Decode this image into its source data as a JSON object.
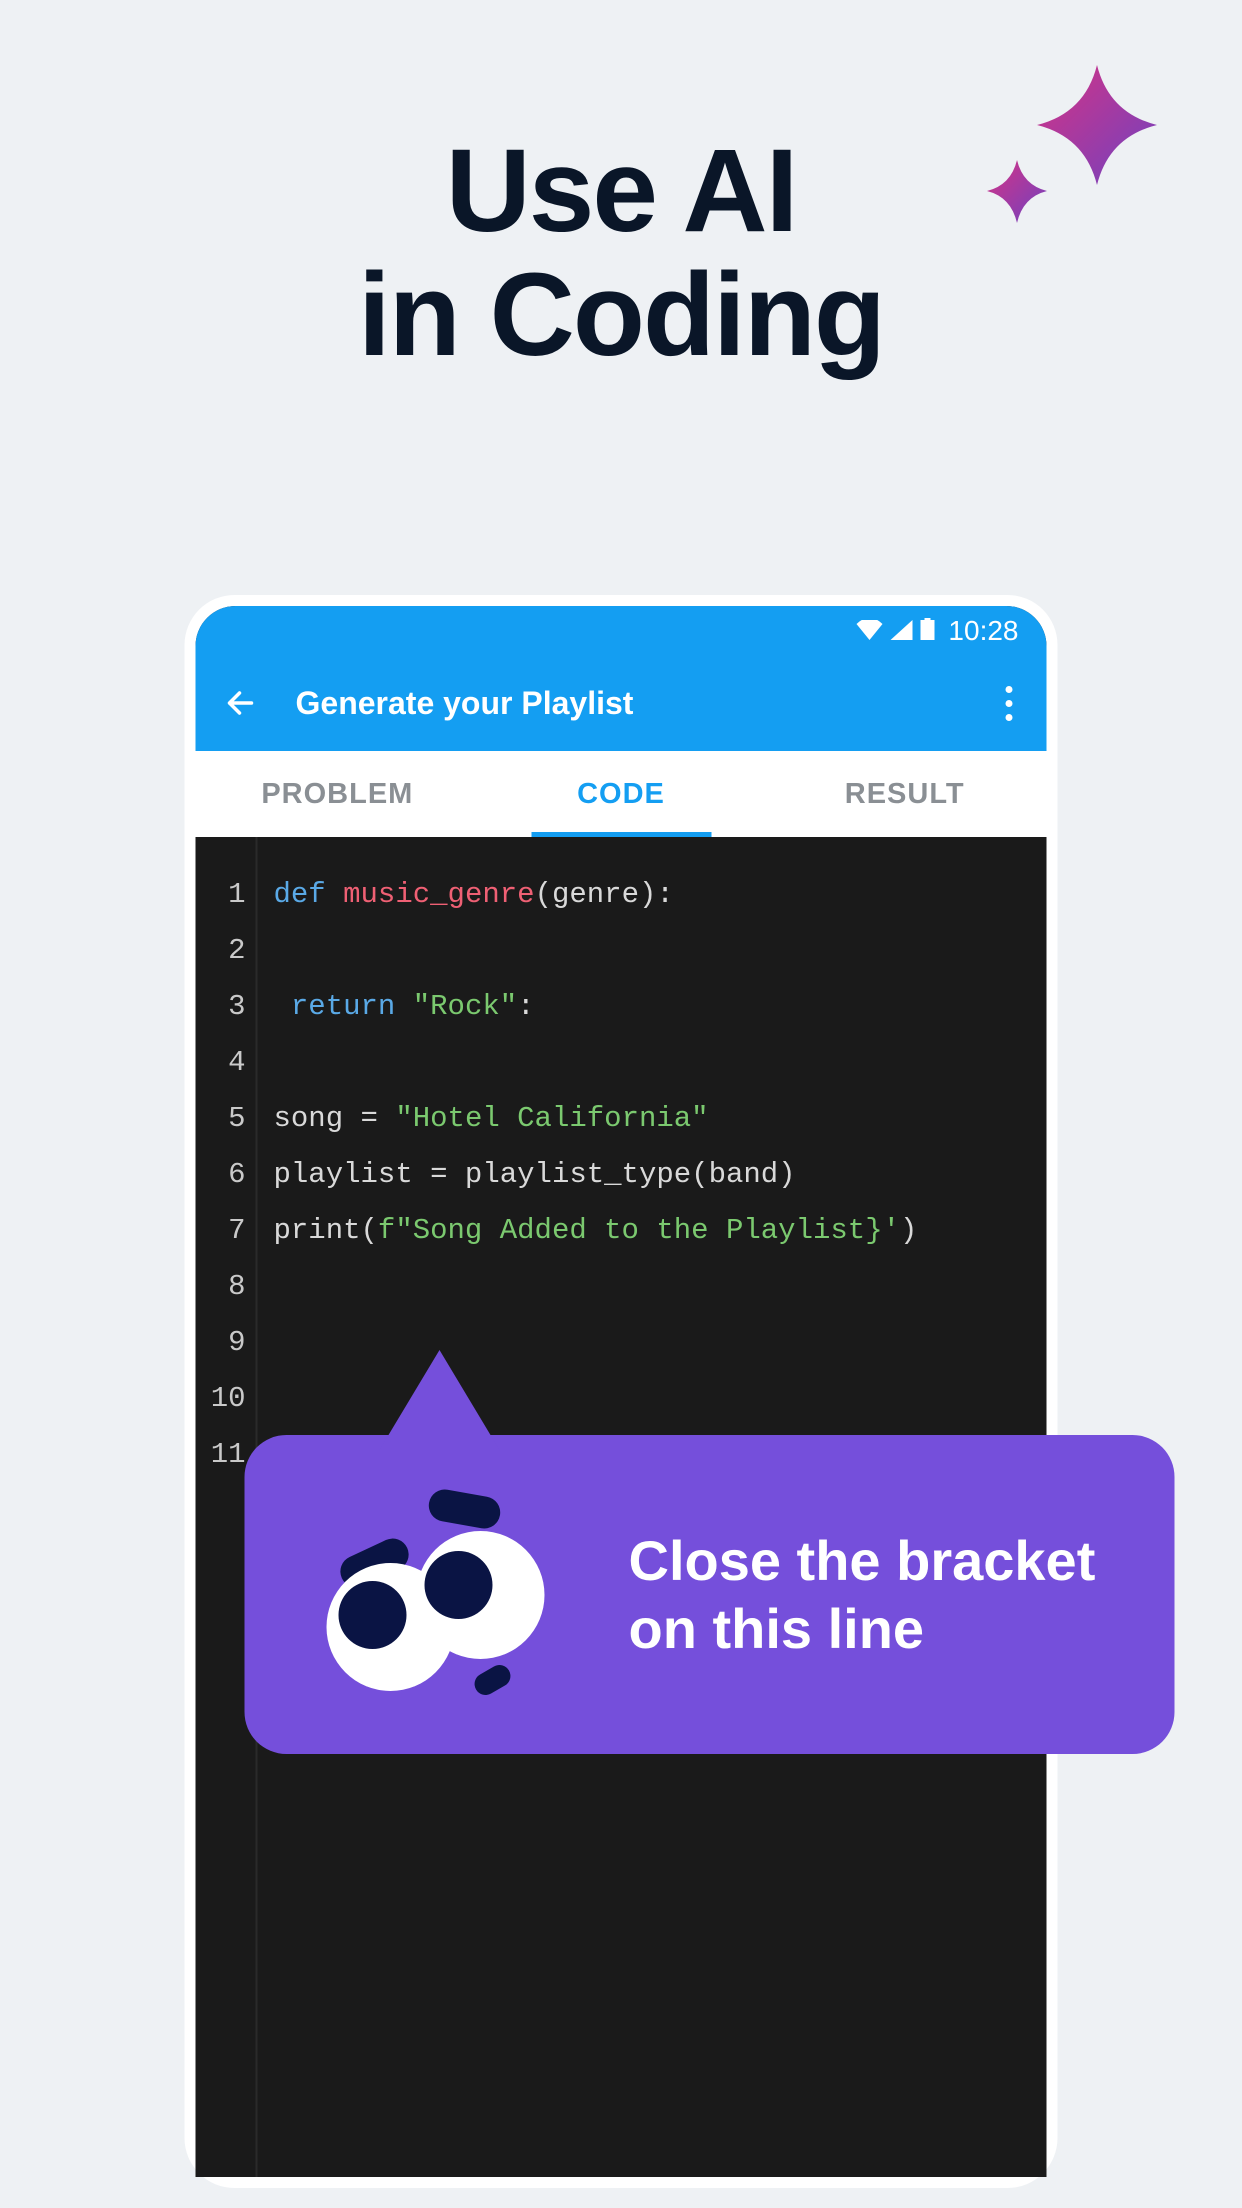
{
  "headline": {
    "line1": "Use AI",
    "line2": "in Coding"
  },
  "status_bar": {
    "time": "10:28"
  },
  "app_bar": {
    "title": "Generate your Playlist"
  },
  "tabs": [
    {
      "label": "PROBLEM",
      "active": false
    },
    {
      "label": "CODE",
      "active": true
    },
    {
      "label": "RESULT",
      "active": false
    }
  ],
  "code": {
    "lines": [
      {
        "n": 1,
        "tokens": [
          {
            "t": "def ",
            "c": "def"
          },
          {
            "t": "music_genre",
            "c": "fn"
          },
          {
            "t": "(genre):",
            "c": "txt"
          }
        ]
      },
      {
        "n": 2,
        "tokens": []
      },
      {
        "n": 3,
        "tokens": [
          {
            "t": " return ",
            "c": "kw"
          },
          {
            "t": "\"Rock\"",
            "c": "str"
          },
          {
            "t": ":",
            "c": "txt"
          }
        ]
      },
      {
        "n": 4,
        "tokens": []
      },
      {
        "n": 5,
        "tokens": [
          {
            "t": "song = ",
            "c": "txt"
          },
          {
            "t": "\"Hotel California\"",
            "c": "str"
          }
        ]
      },
      {
        "n": 6,
        "tokens": [
          {
            "t": "playlist = playlist_type(band)",
            "c": "txt"
          }
        ]
      },
      {
        "n": 7,
        "tokens": [
          {
            "t": "print(",
            "c": "txt"
          },
          {
            "t": "f\"Song Added to the Playlist}'",
            "c": "str"
          },
          {
            "t": ")",
            "c": "txt"
          }
        ]
      },
      {
        "n": 8,
        "tokens": []
      },
      {
        "n": 9,
        "tokens": []
      },
      {
        "n": 10,
        "tokens": []
      },
      {
        "n": 11,
        "tokens": []
      }
    ]
  },
  "ai_tooltip": {
    "text": "Close the bracket on this line"
  }
}
